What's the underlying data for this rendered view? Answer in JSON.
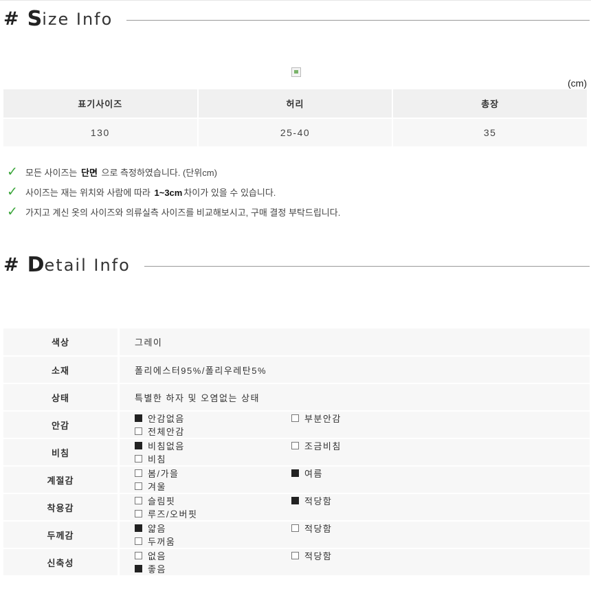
{
  "size_section": {
    "hash": "#",
    "title_first": "S",
    "title_rest": "ize Info",
    "unit": "(cm)",
    "headers": [
      "표기사이즈",
      "허리",
      "총장"
    ],
    "row": [
      "130",
      "25-40",
      "35"
    ]
  },
  "notes": [
    {
      "pre": "모든 사이즈는 ",
      "bold": "단면",
      "post": " 으로 측정하였습니다. (단위cm)"
    },
    {
      "pre": "사이즈는 재는 위치와 사람에 따라 ",
      "bold": "1~3cm",
      "post": "차이가 있을 수 있습니다."
    },
    {
      "pre": "가지고 계신 옷의 사이즈와 의류실측 사이즈를 비교해보시고, 구매 결정 부탁드립니다.",
      "bold": "",
      "post": ""
    }
  ],
  "detail_section": {
    "hash": "#",
    "title_first": "D",
    "title_rest": "etail Info",
    "rows": [
      {
        "label": "색상",
        "text": "그레이"
      },
      {
        "label": "소재",
        "text": "폴리에스터95%/폴리우레탄5%"
      },
      {
        "label": "상태",
        "text": "특별한 하자 및 오염없는 상태"
      },
      {
        "label": "안감",
        "options": [
          {
            "label": "안감없음",
            "checked": true
          },
          {
            "label": "부분안감",
            "checked": false
          },
          {
            "label": "전체안감",
            "checked": false
          }
        ]
      },
      {
        "label": "비침",
        "options": [
          {
            "label": "비침없음",
            "checked": true
          },
          {
            "label": "조금비침",
            "checked": false
          },
          {
            "label": "비침",
            "checked": false
          }
        ]
      },
      {
        "label": "계절감",
        "options": [
          {
            "label": "봄/가을",
            "checked": false
          },
          {
            "label": "여름",
            "checked": true
          },
          {
            "label": "겨울",
            "checked": false
          }
        ]
      },
      {
        "label": "착용감",
        "options": [
          {
            "label": "슬림핏",
            "checked": false
          },
          {
            "label": "적당함",
            "checked": true
          },
          {
            "label": "루즈/오버핏",
            "checked": false
          }
        ]
      },
      {
        "label": "두께감",
        "options": [
          {
            "label": "얇음",
            "checked": true
          },
          {
            "label": "적당함",
            "checked": false
          },
          {
            "label": "두꺼움",
            "checked": false
          }
        ]
      },
      {
        "label": "신축성",
        "options": [
          {
            "label": "없음",
            "checked": false
          },
          {
            "label": "적당함",
            "checked": false
          },
          {
            "label": "좋음",
            "checked": true
          }
        ]
      }
    ]
  },
  "colors": {
    "check": "#3aa53a",
    "header_bg": "#f0f0f0",
    "cell_bg": "#f7f7f7"
  },
  "icons": {
    "note_marker": "checkmark-icon",
    "image_placeholder": "broken-image-icon"
  }
}
